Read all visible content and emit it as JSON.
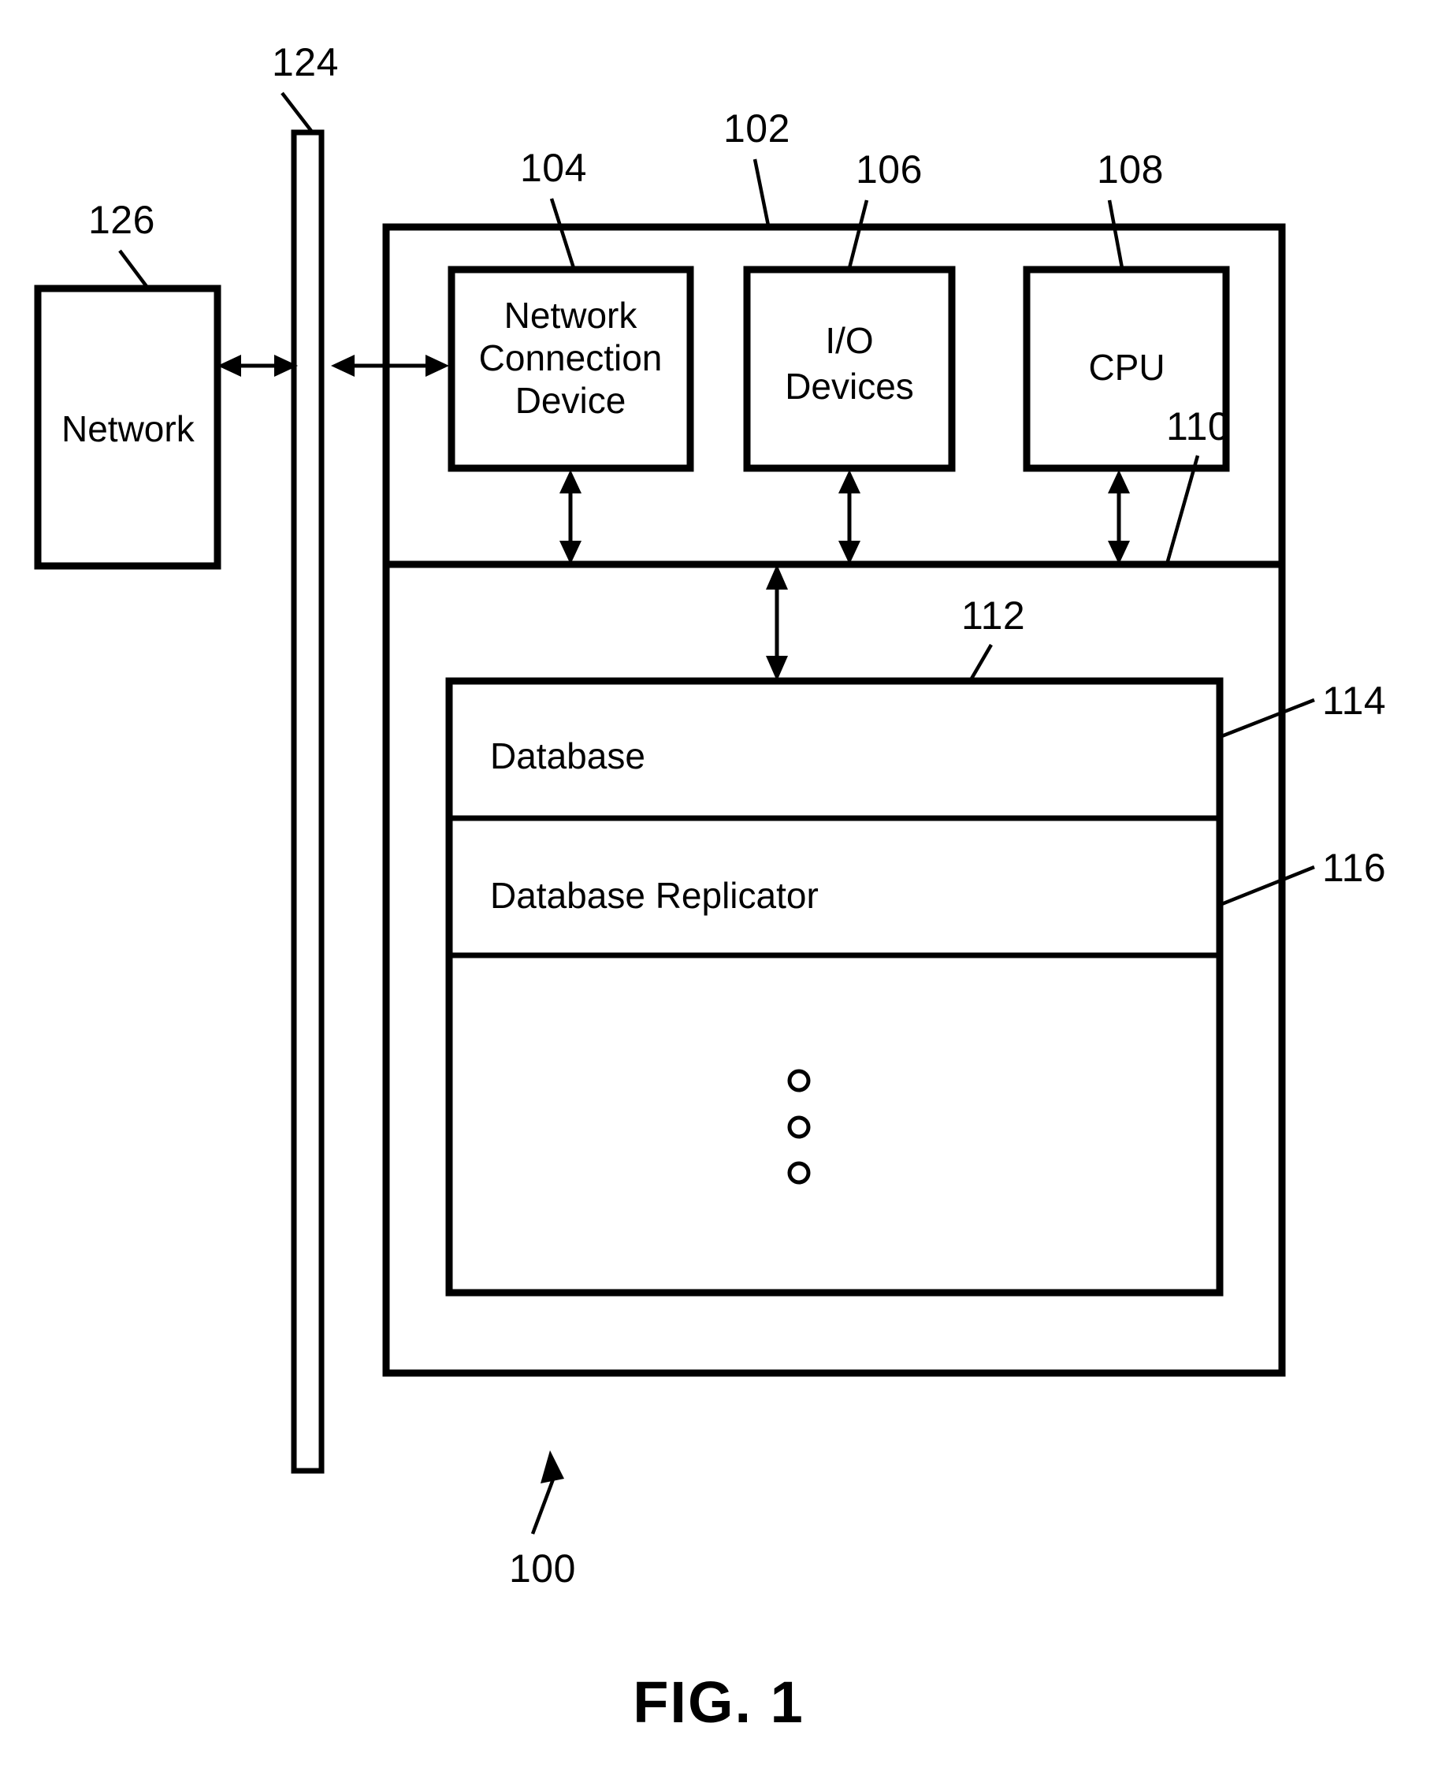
{
  "figure": {
    "caption": "FIG. 1",
    "system_ref": "100"
  },
  "nodes": {
    "network": {
      "label": "Network",
      "ref": "126"
    },
    "bus": {
      "ref": "124"
    },
    "computer": {
      "ref": "102"
    },
    "network_connection_device": {
      "label_line1": "Network",
      "label_line2": "Connection",
      "label_line3": "Device",
      "ref": "104"
    },
    "io_devices": {
      "label_line1": "I/O",
      "label_line2": "Devices",
      "ref": "106"
    },
    "cpu": {
      "label": "CPU",
      "ref": "108"
    },
    "internal_bus": {
      "ref": "110"
    },
    "memory": {
      "ref": "112"
    },
    "database": {
      "label": "Database",
      "ref": "114"
    },
    "database_replicator": {
      "label": "Database Replicator",
      "ref": "116"
    },
    "ellipsis": {
      "glyph": "vertical-ellipsis",
      "count": 3
    }
  },
  "colors": {
    "stroke": "#000000",
    "background": "#ffffff"
  }
}
